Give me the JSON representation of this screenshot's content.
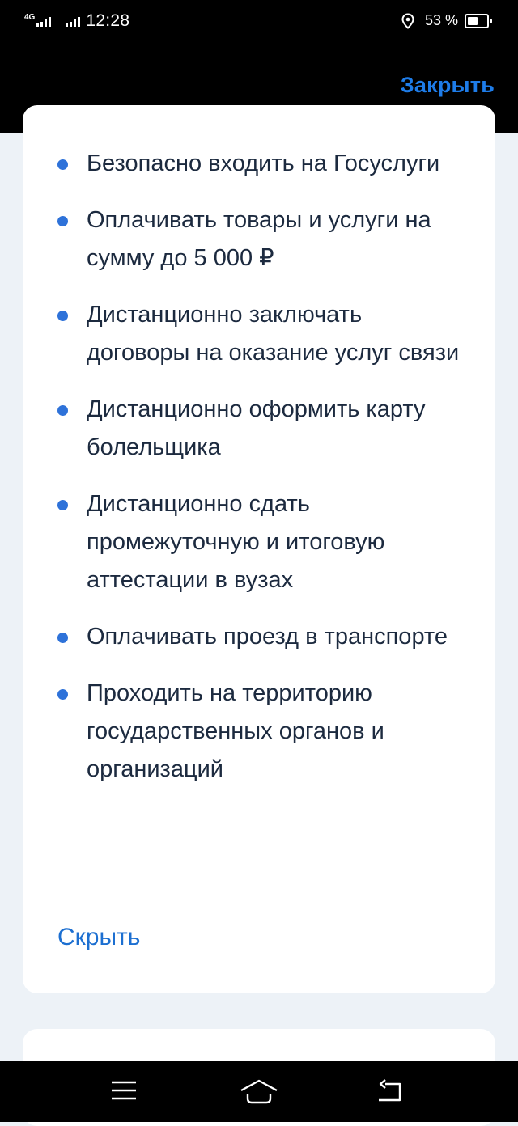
{
  "status_bar": {
    "network": "4G",
    "time": "12:28",
    "battery_percent": "53 %",
    "battery_level": 0.53,
    "icons": [
      "signal-icon",
      "location-icon",
      "battery-icon"
    ]
  },
  "header": {
    "close_label": "Закрыть"
  },
  "card": {
    "benefits": [
      "Безопасно входить на Госуслуги",
      "Оплачивать товары и услуги на сумму до 5 000 ₽",
      "Дистанционно заключать договоры на оказание услуг связи",
      "Дистанционно оформить карту болельщика",
      "Дистанционно сдать промежуточную и итоговую аттестации в вузах",
      "Оплачивать проезд в транспорте",
      "Проходить на территорию государственных органов и организаций"
    ],
    "hide_label": "Скрыть"
  },
  "colors": {
    "accent": "#1e7ce8",
    "bullet": "#2e72d9",
    "text": "#1c2a3f",
    "background": "#edf2f7"
  },
  "nav_bar": {
    "icons": [
      "menu-icon",
      "home-icon",
      "back-icon"
    ]
  }
}
